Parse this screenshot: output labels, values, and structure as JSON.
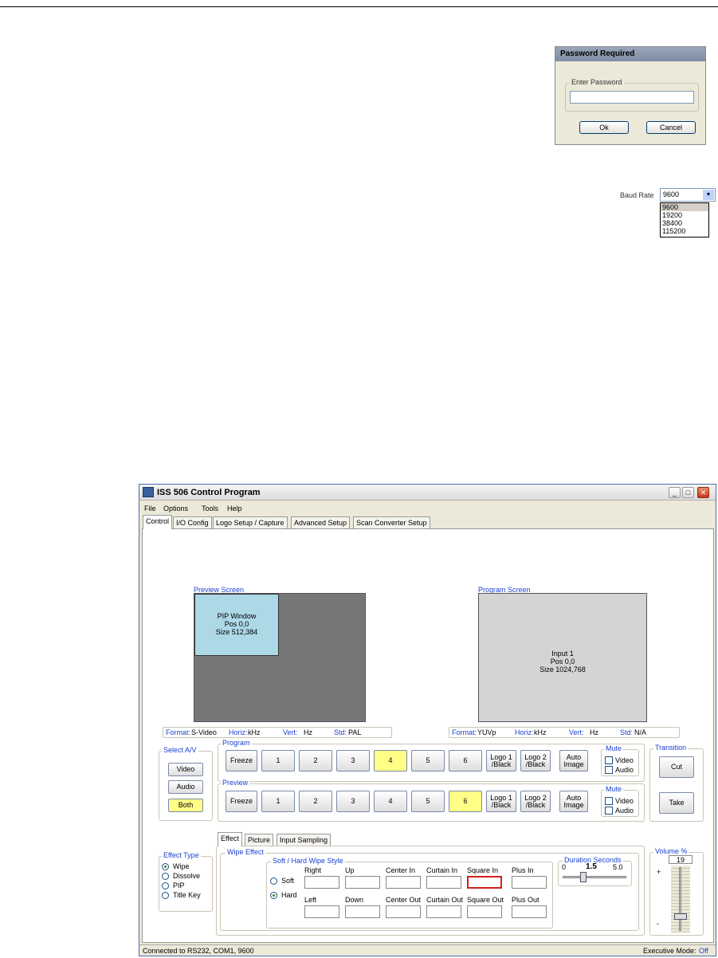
{
  "password_dialog": {
    "title": "Password Required",
    "group_label": "Enter Password",
    "input_value": "",
    "ok_label": "Ok",
    "cancel_label": "Cancel"
  },
  "baud": {
    "label": "Baud Rate",
    "selected": "9600",
    "options": [
      "9600",
      "19200",
      "38400",
      "115200"
    ]
  },
  "window": {
    "title": "ISS 506 Control Program",
    "menu": [
      "File",
      "Options",
      "Tools",
      "Help"
    ],
    "tabs": [
      "Control",
      "I/O Config",
      "Logo Setup / Capture",
      "Advanced Setup",
      "Scan Converter Setup"
    ],
    "preview_screen": {
      "label": "Preview Screen",
      "pip_lines": [
        "PIP Window",
        "Pos 0,0",
        "Size 512,384"
      ]
    },
    "program_screen": {
      "label": "Program Screen",
      "lines": [
        "Input 1",
        "Pos 0,0",
        "Size 1024,768"
      ]
    },
    "preview_info": {
      "format_label": "Format:",
      "format": "S-Video",
      "horiz_label": "Horiz:",
      "horiz": "kHz",
      "vert_label": "Vert:",
      "vert": "Hz",
      "std_label": "Std:",
      "std": "PAL"
    },
    "program_info": {
      "format_label": "Format:",
      "format": "YUVp",
      "horiz_label": "Horiz:",
      "horiz": "kHz",
      "vert_label": "Vert:",
      "vert": "Hz",
      "std_label": "Std:",
      "std": "N/A"
    },
    "select_av": {
      "label": "Select A/V",
      "buttons": [
        "Video",
        "Audio",
        "Both"
      ],
      "active": "Both"
    },
    "program_group": {
      "label": "Program",
      "buttons": [
        "Freeze",
        "1",
        "2",
        "3",
        "4",
        "5",
        "6",
        "Logo 1 /Black",
        "Logo 2 /Black",
        "Auto Image"
      ],
      "active": "4",
      "mute_label": "Mute",
      "mute_video": "Video",
      "mute_audio": "Audio"
    },
    "preview_group": {
      "label": "Preview",
      "buttons": [
        "Freeze",
        "1",
        "2",
        "3",
        "4",
        "5",
        "6",
        "Logo 1 /Black",
        "Logo 2 /Black",
        "Auto Image"
      ],
      "active": "6",
      "mute_label": "Mute",
      "mute_video": "Video",
      "mute_audio": "Audio"
    },
    "transition": {
      "label": "Transition",
      "cut": "Cut",
      "take": "Take"
    },
    "effect_tabs": [
      "Effect",
      "Picture",
      "Input Sampling"
    ],
    "effect_type": {
      "label": "Effect Type",
      "options": [
        "Wipe",
        "Dissolve",
        "PIP",
        "Title Key"
      ],
      "selected": "Wipe"
    },
    "wipe_effect": {
      "label": "Wipe Effect",
      "style_label": "Soft / Hard Wipe Style",
      "soft": "Soft",
      "hard": "Hard",
      "selected": "Hard",
      "top_row": [
        "Right",
        "Up",
        "Center In",
        "Curtain In",
        "Square In",
        "Plus In"
      ],
      "bottom_row": [
        "Left",
        "Down",
        "Center Out",
        "Curtain Out",
        "Square Out",
        "Plus Out"
      ],
      "active": "Square In"
    },
    "duration": {
      "label": "Duration Seconds",
      "min": "0",
      "value": "1.5",
      "max": "5.0",
      "level": 0.3
    },
    "volume": {
      "label": "Volume %",
      "value": "19",
      "plus": "+",
      "minus": "-",
      "level": 0.19
    },
    "status": {
      "connection": "Connected to RS232, COM1, 9600",
      "exec_label": "Executive Mode:",
      "exec_value": "Off"
    }
  }
}
